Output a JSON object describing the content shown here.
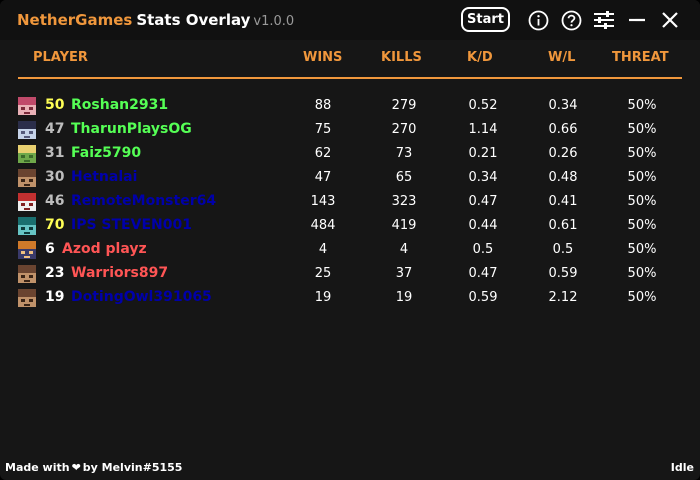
{
  "titlebar": {
    "brand": "NetherGames",
    "app_name": "Stats Overlay",
    "version": "v1.0.0",
    "start_label": "Start",
    "icons": [
      "info-icon",
      "help-icon",
      "settings-sliders-icon",
      "minimize-icon",
      "close-icon"
    ]
  },
  "table": {
    "headers": {
      "player": "PLAYER",
      "wins": "WINS",
      "kills": "KILLS",
      "kd": "K/D",
      "wl": "W/L",
      "threat": "THREAT"
    },
    "accent_color": "#f0973c",
    "rows": [
      {
        "level": "50",
        "level_color": "#ffff55",
        "name": "Roshan2931",
        "name_color": "#55ff55",
        "wins": "88",
        "kills": "279",
        "kd": "0.52",
        "wl": "0.34",
        "threat": "50%",
        "avatar_colors": [
          "#c04a6a",
          "#e9b0b6",
          "#7a2a3a"
        ]
      },
      {
        "level": "47",
        "level_color": "#bdbdbd",
        "name": "TharunPlaysOG",
        "name_color": "#55ff55",
        "wins": "75",
        "kills": "270",
        "kd": "1.14",
        "wl": "0.66",
        "threat": "50%",
        "avatar_colors": [
          "#2b2e4a",
          "#c5d3e8",
          "#555a7a"
        ]
      },
      {
        "level": "31",
        "level_color": "#bdbdbd",
        "name": "Faiz5790",
        "name_color": "#55ff55",
        "wins": "62",
        "kills": "73",
        "kd": "0.21",
        "wl": "0.26",
        "threat": "50%",
        "avatar_colors": [
          "#e8d070",
          "#6fa84a",
          "#3b6b2a"
        ]
      },
      {
        "level": "30",
        "level_color": "#bdbdbd",
        "name": "Hetnalai",
        "name_color": "#0000aa",
        "wins": "47",
        "kills": "65",
        "kd": "0.34",
        "wl": "0.48",
        "threat": "50%",
        "avatar_colors": [
          "#6a4430",
          "#c0926a",
          "#3a2416"
        ]
      },
      {
        "level": "46",
        "level_color": "#bdbdbd",
        "name": "RemoteMonster64",
        "name_color": "#0000aa",
        "wins": "143",
        "kills": "323",
        "kd": "0.47",
        "wl": "0.41",
        "threat": "50%",
        "avatar_colors": [
          "#c23030",
          "#eeeeee",
          "#802020"
        ]
      },
      {
        "level": "70",
        "level_color": "#ffff55",
        "name": "IPS STEVEN001",
        "name_color": "#0000aa",
        "wins": "484",
        "kills": "419",
        "kd": "0.44",
        "wl": "0.61",
        "threat": "50%",
        "avatar_colors": [
          "#1a6f6f",
          "#66c4c4",
          "#0d3a3a"
        ]
      },
      {
        "level": "6",
        "level_color": "#ffffff",
        "name": "Azod playz",
        "name_color": "#ff5555",
        "wins": "4",
        "kills": "4",
        "kd": "0.5",
        "wl": "0.5",
        "threat": "50%",
        "avatar_colors": [
          "#d07a2a",
          "#3a3a6a",
          "#f0c080"
        ]
      },
      {
        "level": "23",
        "level_color": "#ffffff",
        "name": "Warriors897",
        "name_color": "#ff5555",
        "wins": "25",
        "kills": "37",
        "kd": "0.47",
        "wl": "0.59",
        "threat": "50%",
        "avatar_colors": [
          "#6a4430",
          "#c0926a",
          "#3a2416"
        ]
      },
      {
        "level": "19",
        "level_color": "#ffffff",
        "name": "DotingOwl391065",
        "name_color": "#0000aa",
        "wins": "19",
        "kills": "19",
        "kd": "0.59",
        "wl": "2.12",
        "threat": "50%",
        "avatar_colors": [
          "#6a4430",
          "#c0926a",
          "#3a2416"
        ]
      }
    ]
  },
  "footer": {
    "made_with": "Made with",
    "by": "by Melvin#5155",
    "status": "Idle"
  }
}
